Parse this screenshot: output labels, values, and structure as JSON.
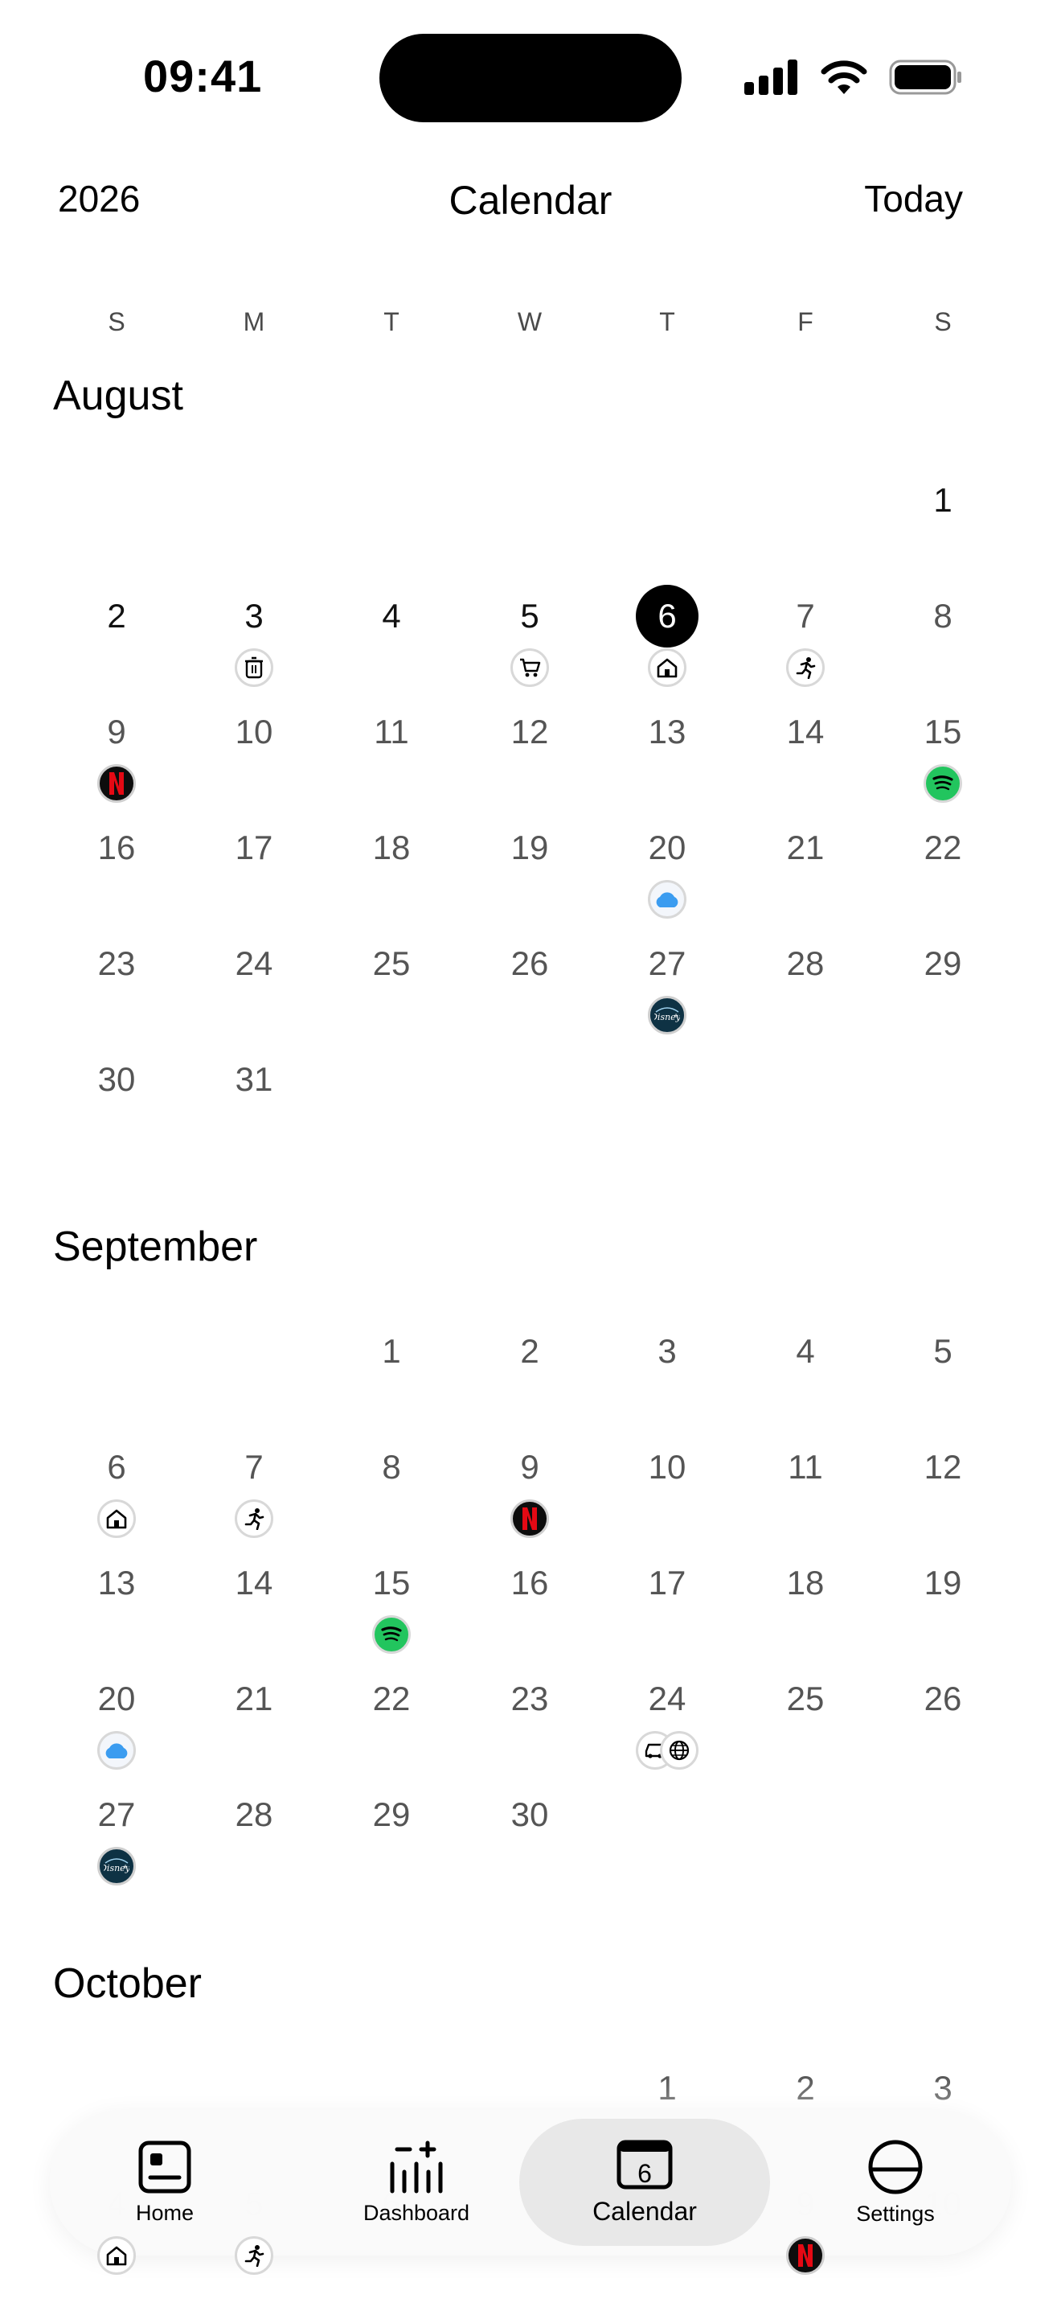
{
  "status_bar": {
    "time": "09:41"
  },
  "header": {
    "year": "2026",
    "title": "Calendar",
    "today_button": "Today"
  },
  "weekdays": [
    "S",
    "M",
    "T",
    "W",
    "T",
    "F",
    "S"
  ],
  "months": [
    {
      "name": "August",
      "first_weekday": 6,
      "days_in_month": 31,
      "today": 6,
      "events": [
        {
          "day": 3,
          "icons": [
            "trash-icon"
          ]
        },
        {
          "day": 5,
          "icons": [
            "cart-icon"
          ]
        },
        {
          "day": 6,
          "icons": [
            "home-icon"
          ]
        },
        {
          "day": 7,
          "icons": [
            "running-icon"
          ]
        },
        {
          "day": 9,
          "icons": [
            "netflix-icon"
          ]
        },
        {
          "day": 15,
          "icons": [
            "spotify-icon"
          ]
        },
        {
          "day": 20,
          "icons": [
            "icloud-icon"
          ]
        },
        {
          "day": 27,
          "icons": [
            "disney-plus-icon"
          ]
        }
      ]
    },
    {
      "name": "September",
      "first_weekday": 2,
      "days_in_month": 30,
      "today": null,
      "events": [
        {
          "day": 6,
          "icons": [
            "home-icon"
          ]
        },
        {
          "day": 7,
          "icons": [
            "running-icon"
          ]
        },
        {
          "day": 9,
          "icons": [
            "netflix-icon"
          ]
        },
        {
          "day": 15,
          "icons": [
            "spotify-icon"
          ]
        },
        {
          "day": 20,
          "icons": [
            "icloud-icon"
          ]
        },
        {
          "day": 24,
          "icons": [
            "car-icon",
            "globe-icon"
          ]
        },
        {
          "day": 27,
          "icons": [
            "disney-plus-icon"
          ]
        }
      ]
    },
    {
      "name": "October",
      "first_weekday": 4,
      "days_in_month": 31,
      "today": null,
      "events": [
        {
          "day": 4,
          "icons": [
            "home-icon"
          ]
        },
        {
          "day": 5,
          "icons": [
            "running-icon"
          ]
        },
        {
          "day": 9,
          "icons": [
            "netflix-icon"
          ]
        }
      ]
    }
  ],
  "tabs": [
    {
      "label": "Home",
      "icon": "home-card-icon",
      "active": false
    },
    {
      "label": "Dashboard",
      "icon": "dashboard-icon",
      "active": false
    },
    {
      "label": "Calendar",
      "icon": "calendar-icon",
      "active": true,
      "badge": "6"
    },
    {
      "label": "Settings",
      "icon": "settings-icon",
      "active": false
    }
  ],
  "colors": {
    "today_fill": "#000000",
    "spotify": "#22c55e",
    "netflix_red": "#e50914",
    "icloud": "#3b9cf0",
    "disney": "#0e3244"
  }
}
